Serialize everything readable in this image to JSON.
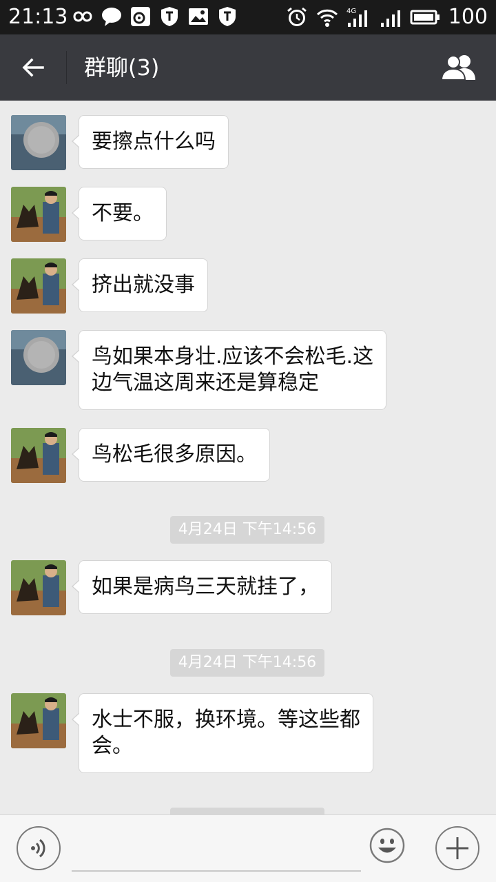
{
  "status_bar": {
    "time": "21:13",
    "left_icons": [
      "infinity-icon",
      "chat-bubble-icon",
      "weibo-icon",
      "shield-icon",
      "image-icon",
      "shield-icon"
    ],
    "right_icons": [
      "alarm-icon",
      "wifi-icon",
      "signal-4g-icon",
      "signal-icon",
      "battery-icon"
    ],
    "network_label": "4G",
    "battery": "100"
  },
  "header": {
    "title": "群聊(3)",
    "back_icon": "back-arrow-icon",
    "members_icon": "group-members-icon"
  },
  "messages": [
    {
      "avatar": "blurred-avatar",
      "text": "要擦点什么吗"
    },
    {
      "avatar": "photo-avatar-dog",
      "text": "不要。"
    },
    {
      "avatar": "photo-avatar-dog",
      "text": "挤出就没事"
    },
    {
      "avatar": "blurred-avatar",
      "text": "鸟如果本身壮.应该不会松毛.这\n边气温这周来还是算稳定"
    },
    {
      "avatar": "photo-avatar-dog",
      "text": "鸟松毛很多原因。"
    },
    {
      "avatar": "photo-avatar-dog",
      "text": "如果是病鸟三天就挂了，"
    },
    {
      "avatar": "photo-avatar-dog",
      "text": "水士不服，换环境。等这些都\n会。"
    }
  ],
  "timestamps": [
    "4月24日 下午14:56",
    "4月24日 下午14:56"
  ],
  "input_bar": {
    "voice_icon": "voice-icon",
    "input_value": "",
    "emoji_icon": "emoji-icon",
    "plus_icon": "plus-icon"
  },
  "colors": {
    "status_bar": "#1a1a1a",
    "title_bar": "#393a3f",
    "chat_background": "#ebebeb",
    "bubble": "#ffffff",
    "timestamp_pill": "#d6d6d6"
  }
}
